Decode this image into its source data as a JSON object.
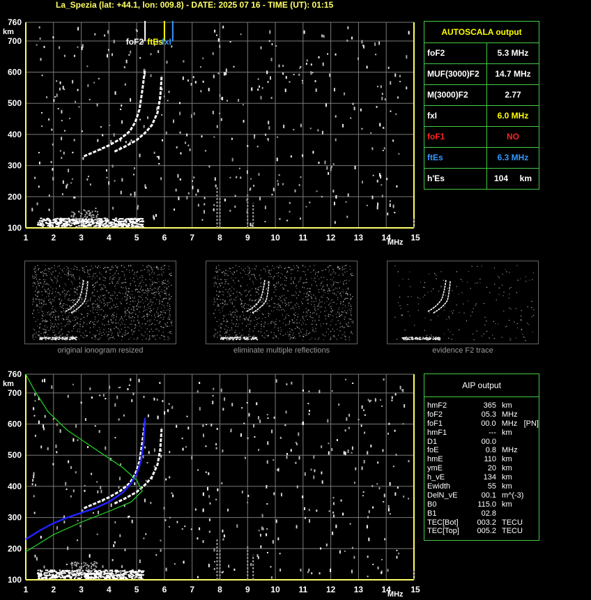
{
  "header": {
    "station": "La_Spezia",
    "text": "La_Spezia (lat: +44.1, lon: 009.8) - DATE: 2025 07 16 - TIME (UT): 01:15"
  },
  "colors": {
    "grid": "#7a7a7a",
    "axis": "#ffff66",
    "box_border": "#44cc44",
    "trace": "#ffffff",
    "model_profile": "#2222ff",
    "density_curve": "#22cc22",
    "foF2_marker": "#ffffff",
    "fxI_marker": "#ffff00",
    "ftEs_marker": "#3399ff",
    "red_value": "#ff2222",
    "blue_value": "#3399ff",
    "yellow_value": "#ffff00"
  },
  "chart_data": [
    {
      "type": "scatter",
      "name_hint": "ionogram-top",
      "x_unit_label": "MHz",
      "y_unit_label": "km",
      "xlim": [
        1,
        15
      ],
      "ylim": [
        100,
        760
      ],
      "x_ticks": [
        1,
        2,
        3,
        4,
        5,
        6,
        7,
        8,
        9,
        10,
        11,
        12,
        13,
        14,
        15
      ],
      "y_ticks": [
        100,
        200,
        300,
        400,
        500,
        600,
        700,
        760
      ],
      "markers": [
        {
          "label": "foF2",
          "freq": 5.3,
          "color": "#ffffff"
        },
        {
          "label": "ftEs",
          "freq": 6.0,
          "color": "#ffff00"
        },
        {
          "label": "fxI",
          "freq": 6.3,
          "color": "#3399ff"
        }
      ],
      "trace_o": {
        "x": [
          3.1,
          3.5,
          4.0,
          4.4,
          4.75,
          4.95,
          5.1,
          5.2,
          5.3
        ],
        "y": [
          330,
          345,
          365,
          385,
          410,
          440,
          480,
          540,
          610
        ]
      },
      "trace_x": {
        "x": [
          4.2,
          4.6,
          5.0,
          5.3,
          5.55,
          5.75,
          5.85,
          5.9
        ],
        "y": [
          345,
          362,
          382,
          405,
          430,
          470,
          520,
          590
        ]
      },
      "grid": true
    },
    {
      "type": "scatter",
      "name_hint": "ionogram-bottom",
      "x_unit_label": "MHz",
      "y_unit_label": "km",
      "xlim": [
        1,
        15
      ],
      "ylim": [
        100,
        760
      ],
      "x_ticks": [
        1,
        2,
        3,
        4,
        5,
        6,
        7,
        8,
        9,
        10,
        11,
        12,
        13,
        14,
        15
      ],
      "y_ticks": [
        100,
        200,
        300,
        400,
        500,
        600,
        700,
        760
      ],
      "model_profile": {
        "x": [
          1.0,
          1.5,
          2.0,
          2.5,
          3.0,
          3.5,
          4.0,
          4.5,
          4.8,
          5.0,
          5.15,
          5.25,
          5.3
        ],
        "y": [
          230,
          258,
          282,
          300,
          315,
          330,
          350,
          380,
          410,
          440,
          480,
          540,
          620
        ]
      },
      "density_curve": {
        "x": [
          1.0,
          2.0,
          3.0,
          4.0,
          4.8,
          5.2,
          5.0,
          4.5,
          3.5,
          2.5,
          1.8,
          1.3,
          1.0
        ],
        "y": [
          190,
          245,
          285,
          320,
          350,
          385,
          420,
          460,
          520,
          580,
          640,
          710,
          760
        ]
      },
      "grid": true
    }
  ],
  "autoscala": {
    "title": "AUTOSCALA output",
    "rows": [
      {
        "key": "foF2",
        "value": "5.3 MHz",
        "key_color": "#ffffff",
        "val_color": "#ffffff"
      },
      {
        "key": "MUF(3000)F2",
        "value": "14.7 MHz",
        "key_color": "#ffffff",
        "val_color": "#ffffff"
      },
      {
        "key": "M(3000)F2",
        "value": "2.77",
        "key_color": "#ffffff",
        "val_color": "#ffffff"
      },
      {
        "key": "fxI",
        "value": "6.0 MHz",
        "key_color": "#ffffff",
        "val_color": "#ffff00"
      },
      {
        "key": "foF1",
        "value": "NO",
        "key_color": "#ff2222",
        "val_color": "#ff2222"
      },
      {
        "key": "ftEs",
        "value": "6.3 MHz",
        "key_color": "#3399ff",
        "val_color": "#3399ff"
      },
      {
        "key": "h'Es",
        "value": "104     km",
        "key_color": "#ffffff",
        "val_color": "#ffffff"
      }
    ]
  },
  "panels": [
    {
      "caption": "original ionogram resized"
    },
    {
      "caption": "eliminate multiple reflections"
    },
    {
      "caption": "evidence F2 trace"
    }
  ],
  "aip": {
    "title": "AIP output",
    "rows": [
      [
        "hmF2",
        "365",
        "km",
        ""
      ],
      [
        "foF2",
        "05.3",
        "MHz",
        ""
      ],
      [
        "foF1",
        "00.0",
        "MHz",
        "[PN]"
      ],
      [
        "hmF1",
        "---",
        "km",
        ""
      ],
      [
        "D1",
        "00.0",
        "",
        ""
      ],
      [
        "foE",
        "0.8",
        "MHz",
        ""
      ],
      [
        "hmE",
        "110",
        "km",
        ""
      ],
      [
        "ymE",
        "20",
        "km",
        ""
      ],
      [
        "h_vE",
        "134",
        "km",
        ""
      ],
      [
        "Ewidth",
        "55",
        "km",
        ""
      ],
      [
        "DelN_vE",
        "00.1",
        "m^(-3)",
        ""
      ],
      [
        "B0",
        "115.0",
        "km",
        ""
      ],
      [
        "B1",
        "02.8",
        "",
        ""
      ],
      [
        "TEC[Bot]",
        "003.2",
        "TECU",
        ""
      ],
      [
        "TEC[Top]",
        "005.2",
        "TECU",
        ""
      ]
    ]
  }
}
